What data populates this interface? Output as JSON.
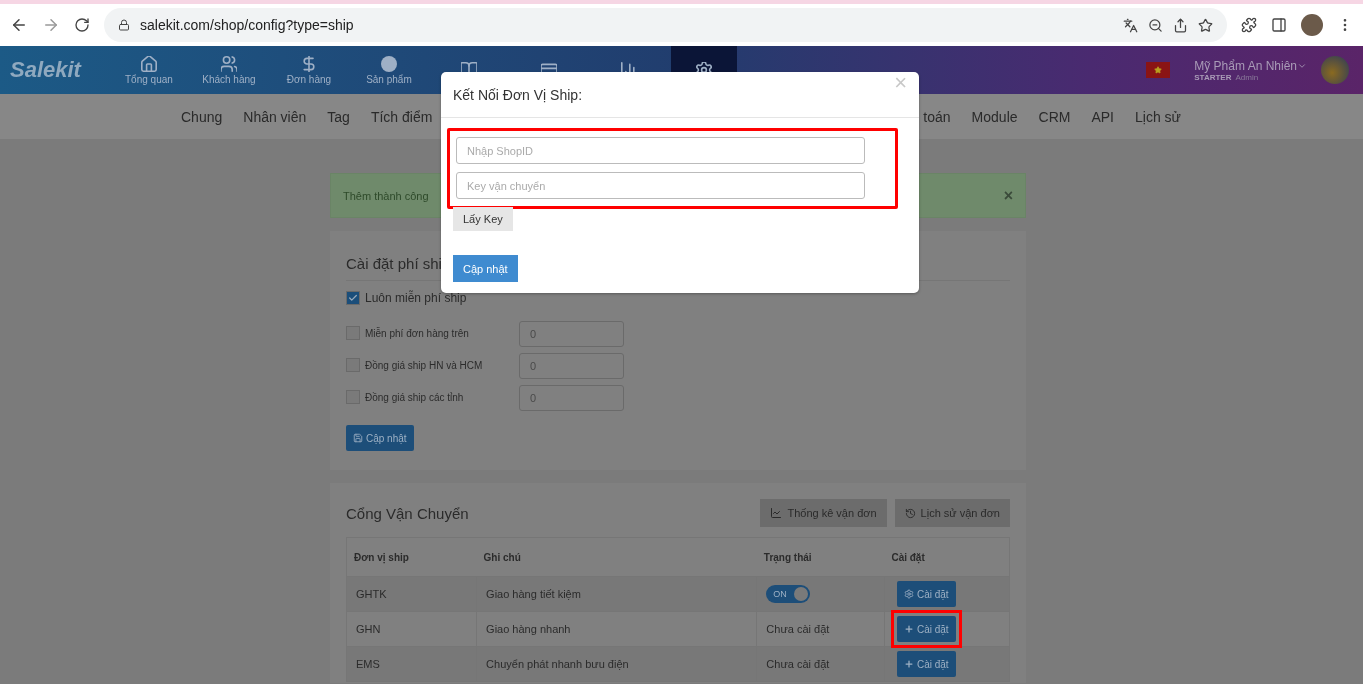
{
  "browser": {
    "url": "salekit.com/shop/config?type=ship"
  },
  "header": {
    "brand": "Salekit",
    "nav": [
      {
        "label": "Tổng quan",
        "selected": false
      },
      {
        "label": "Khách hàng",
        "selected": false
      },
      {
        "label": "Đơn hàng",
        "selected": false
      },
      {
        "label": "Sản phẩm",
        "selected": false
      },
      {
        "selected": false
      },
      {
        "selected": false
      },
      {
        "selected": false
      },
      {
        "selected": true
      }
    ],
    "user": {
      "name": "Mỹ Phẩm An Nhiên",
      "plan": "STARTER",
      "role": "Admin"
    }
  },
  "subnav": [
    "Chung",
    "Nhân viên",
    "Tag",
    "Tích điểm",
    "toán",
    "Module",
    "CRM",
    "API",
    "Lịch sử"
  ],
  "alert": {
    "text": "Thêm thành công",
    "close": "×"
  },
  "fee_settings": {
    "title": "Cài đặt phí shi",
    "always_free": {
      "label": "Luôn miễn phí ship",
      "checked": true
    },
    "rows": [
      {
        "label": "Miễn phí đơn hàng trên",
        "checked": false,
        "value": "0"
      },
      {
        "label": "Đồng giá ship HN và HCM",
        "checked": false,
        "value": "0"
      },
      {
        "label": "Đồng giá ship các tỉnh",
        "checked": false,
        "value": "0"
      }
    ],
    "button": "Cập nhật"
  },
  "shipping": {
    "title": "Cổng Vận Chuyển",
    "buttons": [
      "Thống kê vận đơn",
      "Lịch sử vận đơn"
    ],
    "columns": [
      "Đơn vị ship",
      "Ghi chú",
      "Trạng thái",
      "Cài đặt"
    ],
    "rows": [
      {
        "carrier": "GHTK",
        "note": "Giao hàng tiết kiệm",
        "status": {
          "kind": "toggle",
          "on": true,
          "label": "ON"
        },
        "action": {
          "kind": "settings",
          "label": "Cài đặt"
        },
        "highlighted": false
      },
      {
        "carrier": "GHN",
        "note": "Giao hàng nhanh",
        "status": {
          "kind": "text",
          "label": "Chưa cài đặt"
        },
        "action": {
          "kind": "add",
          "label": "Cài đặt"
        },
        "highlighted": true
      },
      {
        "carrier": "EMS",
        "note": "Chuyển phát nhanh bưu điện",
        "status": {
          "kind": "text",
          "label": "Chưa cài đặt"
        },
        "action": {
          "kind": "add",
          "label": "Cài đặt"
        },
        "highlighted": false
      }
    ]
  },
  "modal": {
    "title": "Kết Nối Đơn Vị Ship:",
    "close": "×",
    "fields": [
      {
        "placeholder": "Nhập ShopID"
      },
      {
        "placeholder": "Key vận chuyển"
      }
    ],
    "fields_highlighted": true,
    "key_button": "Lấy Key",
    "submit": "Cập nhật"
  }
}
